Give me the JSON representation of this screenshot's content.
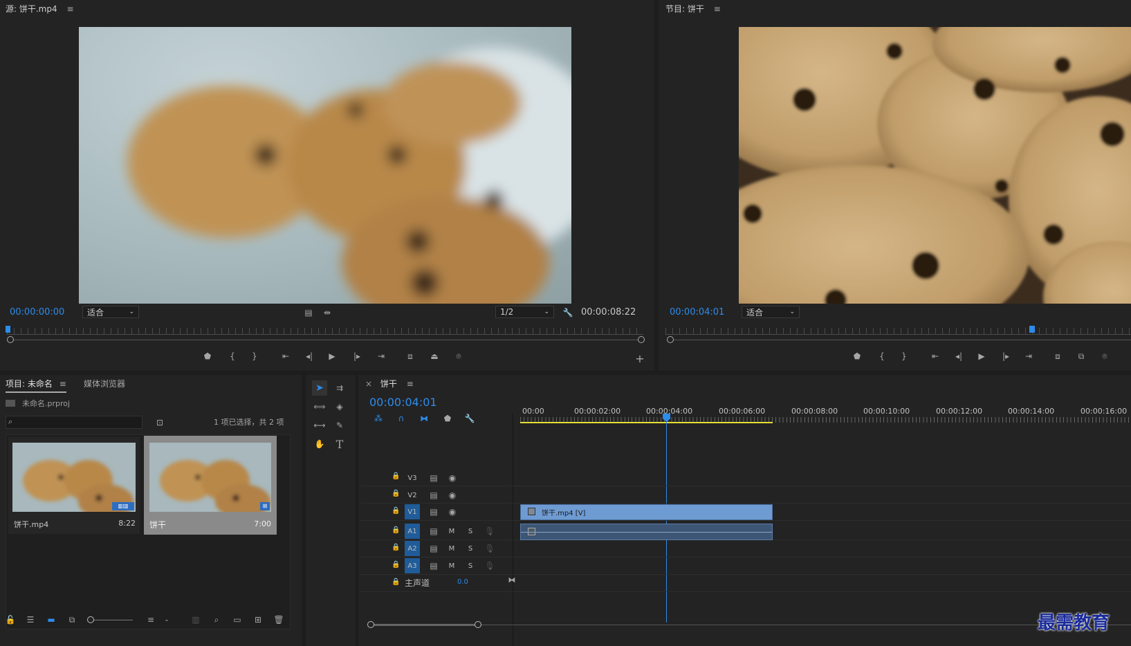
{
  "source": {
    "title": "源: 饼干.mp4",
    "timecode": "00:00:00:00",
    "fit": "适合",
    "resolution": "1/2",
    "duration": "00:00:08:22"
  },
  "program": {
    "title": "节目: 饼干",
    "timecode": "00:00:04:01",
    "fit": "适合"
  },
  "project": {
    "tab_project": "项目: 未命名",
    "tab_media": "媒体浏览器",
    "file": "未命名.prproj",
    "selection_info": "1 项已选择，共 2 项",
    "items": [
      {
        "name": "饼干.mp4",
        "duration": "8:22"
      },
      {
        "name": "饼干",
        "duration": "7:00"
      }
    ]
  },
  "timeline": {
    "sequence": "饼干",
    "timecode": "00:00:04:01",
    "ruler": [
      "00:00",
      "00:00:02:00",
      "00:00:04:00",
      "00:00:06:00",
      "00:00:08:00",
      "00:00:10:00",
      "00:00:12:00",
      "00:00:14:00",
      "00:00:16:00"
    ],
    "video_tracks": [
      "V3",
      "V2",
      "V1"
    ],
    "audio_tracks": [
      "A1",
      "A2",
      "A3"
    ],
    "track_m": "M",
    "track_s": "S",
    "master_label": "主声道",
    "master_value": "0.0",
    "clip_video_label": "饼干.mp4 [V]"
  },
  "colors": {
    "accent": "#2d8ceb",
    "clip_video": "#6f9bd3",
    "clip_audio": "#3d5675",
    "work_area": "#e5e034"
  },
  "watermark": "最需教育"
}
